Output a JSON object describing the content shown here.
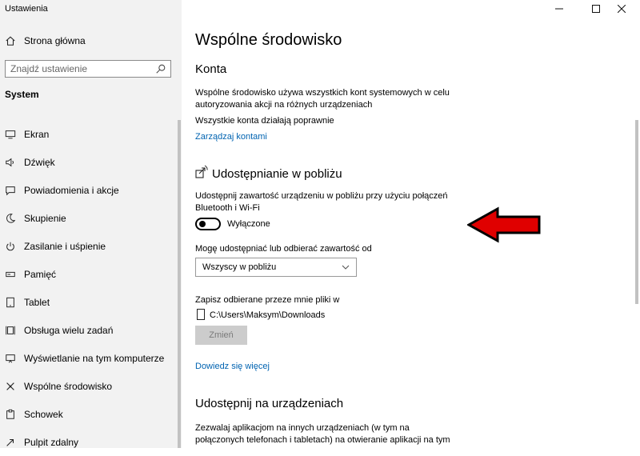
{
  "window": {
    "app_title": "Ustawienia",
    "controls": [
      "minimize",
      "maximize",
      "close"
    ]
  },
  "sidebar": {
    "home_label": "Strona główna",
    "search_placeholder": "Znajdź ustawienie",
    "section": "System",
    "items": [
      {
        "label": "Ekran",
        "icon": "monitor-icon"
      },
      {
        "label": "Dźwięk",
        "icon": "speaker-icon"
      },
      {
        "label": "Powiadomienia i akcje",
        "icon": "notification-icon"
      },
      {
        "label": "Skupienie",
        "icon": "moon-icon"
      },
      {
        "label": "Zasilanie i uśpienie",
        "icon": "power-icon"
      },
      {
        "label": "Pamięć",
        "icon": "storage-icon"
      },
      {
        "label": "Tablet",
        "icon": "tablet-icon"
      },
      {
        "label": "Obsługa wielu zadań",
        "icon": "multitasking-icon"
      },
      {
        "label": "Wyświetlanie na tym komputerze",
        "icon": "project-icon"
      },
      {
        "label": "Wspólne środowisko",
        "icon": "shared-experiences-icon"
      },
      {
        "label": "Schowek",
        "icon": "clipboard-icon"
      },
      {
        "label": "Pulpit zdalny",
        "icon": "remote-desktop-icon"
      }
    ]
  },
  "main": {
    "title": "Wspólne środowisko",
    "accounts": {
      "heading": "Konta",
      "description": "Wspólne środowisko używa wszystkich kont systemowych w celu autoryzowania akcji na różnych urządzeniach",
      "status": "Wszystkie konta działają poprawnie",
      "manage_link": "Zarządzaj kontami"
    },
    "nearby": {
      "heading": "Udostępnianie w pobliżu",
      "description": "Udostępnij zawartość urządzeniu w pobliżu przy użyciu połączeń Bluetooth i Wi-Fi",
      "toggle_state": "Wyłączone",
      "share_from_label": "Mogę udostępniać lub odbierać zawartość od",
      "share_from_value": "Wszyscy w pobliżu",
      "save_label": "Zapisz odbierane przeze mnie pliki w",
      "save_path": "C:\\Users\\Maksym\\Downloads",
      "change_button": "Zmień",
      "learn_more": "Dowiedz się więcej"
    },
    "across_devices": {
      "heading": "Udostępnij na urządzeniach",
      "description": "Zezwalaj aplikacjom na innych urządzeniach (w tym na połączonych telefonach i tabletach) na otwieranie aplikacji na tym"
    }
  },
  "annotation": {
    "arrow_color": "#e00000"
  }
}
